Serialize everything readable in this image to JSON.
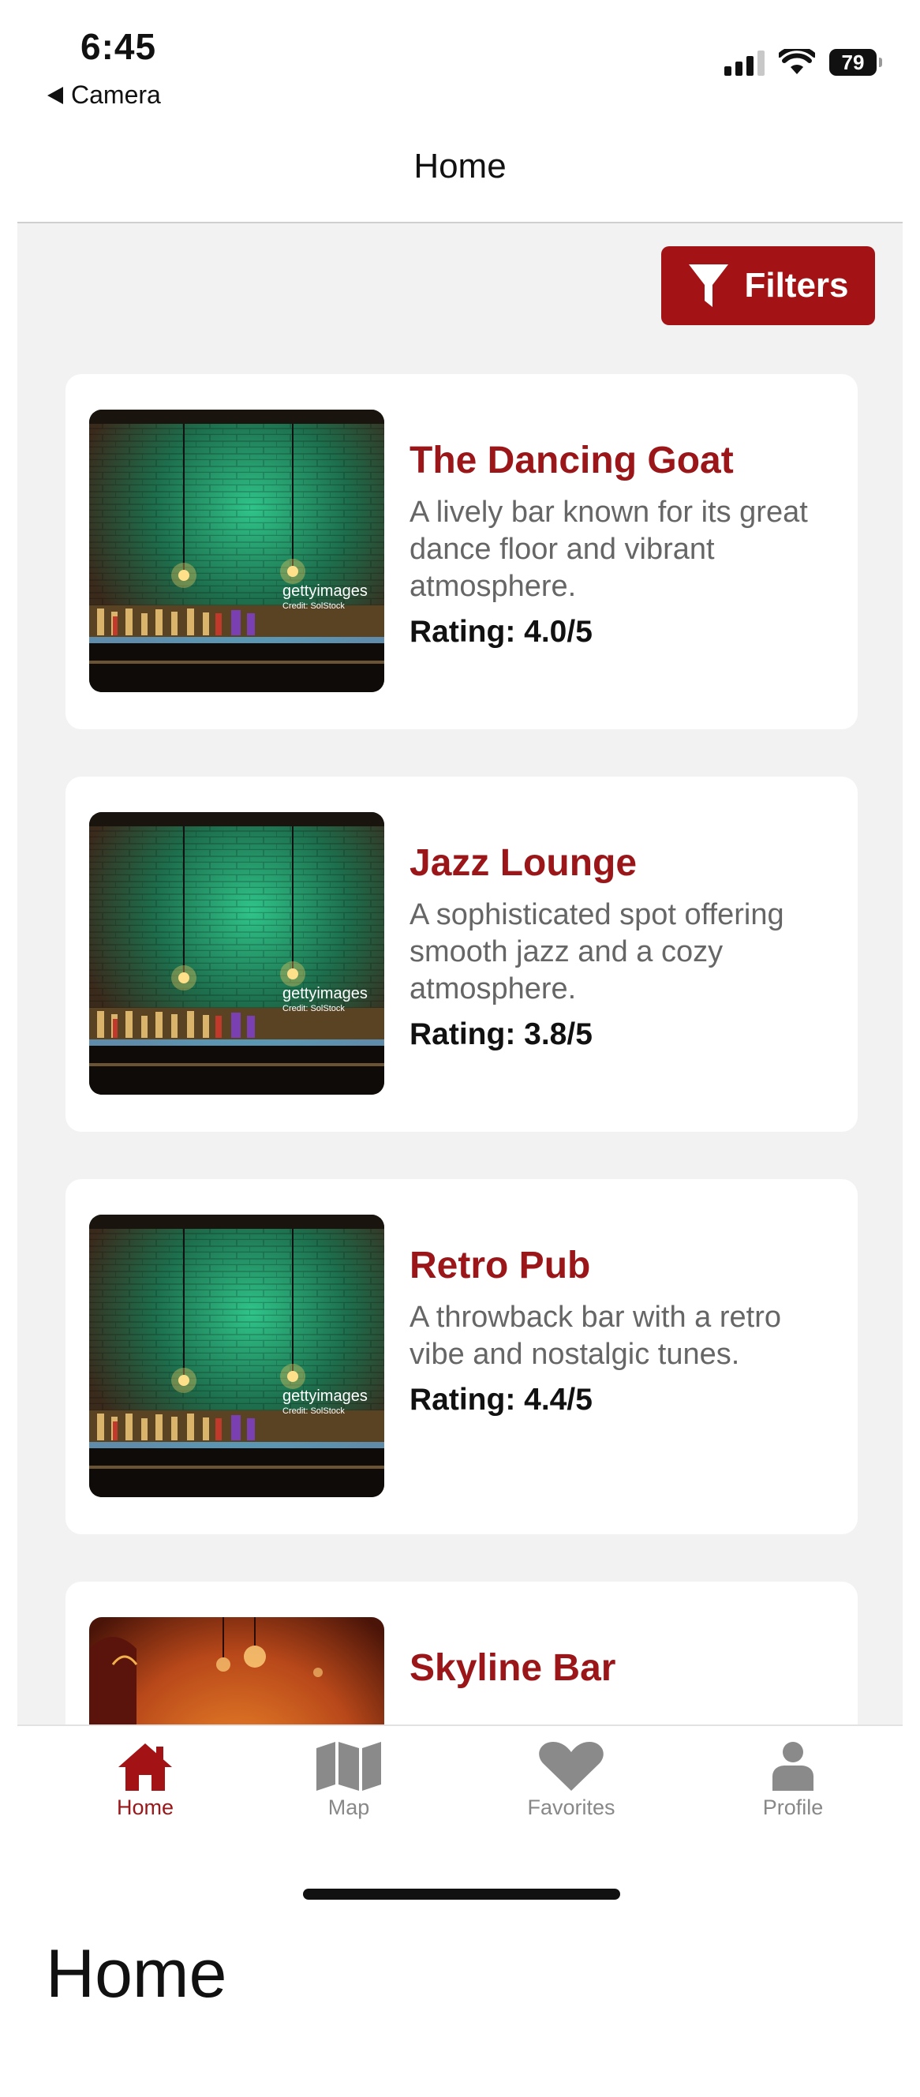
{
  "status_bar": {
    "time": "6:45",
    "back_label": "Camera",
    "battery": "79"
  },
  "nav": {
    "title": "Home"
  },
  "filters": {
    "label": "Filters"
  },
  "bars": [
    {
      "name": "The Dancing Goat",
      "description": "A lively bar known for its great dance floor and vibrant atmosphere.",
      "rating": "Rating: 4.0/5",
      "watermark": "gettyimages",
      "credit": "Credit: SolStock"
    },
    {
      "name": "Jazz Lounge",
      "description": "A sophisticated spot offering smooth jazz and a cozy atmosphere.",
      "rating": "Rating: 3.8/5",
      "watermark": "gettyimages",
      "credit": "Credit: SolStock"
    },
    {
      "name": "Retro Pub",
      "description": "A throwback bar with a retro vibe and nostalgic tunes.",
      "rating": "Rating: 4.4/5",
      "watermark": "gettyimages",
      "credit": "Credit: SolStock"
    },
    {
      "name": "Skyline Bar"
    }
  ],
  "tabs": [
    {
      "label": "Home",
      "icon": "home-icon",
      "active": true
    },
    {
      "label": "Map",
      "icon": "map-icon",
      "active": false
    },
    {
      "label": "Favorites",
      "icon": "heart-icon",
      "active": false
    },
    {
      "label": "Profile",
      "icon": "person-icon",
      "active": false
    }
  ],
  "caption": "Home",
  "colors": {
    "accent": "#a31316",
    "title_red": "#9a1619",
    "background": "#f2f2f2",
    "inactive_tab": "#888888"
  }
}
